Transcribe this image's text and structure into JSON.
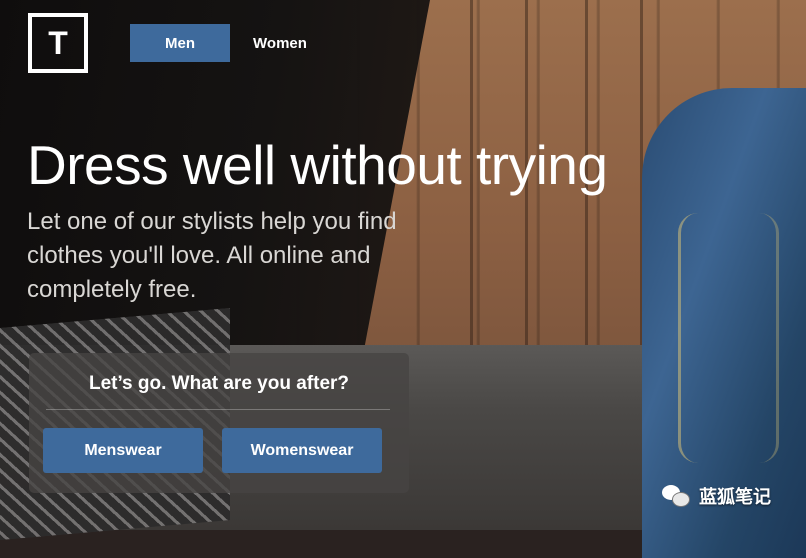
{
  "brand": {
    "logo_letter": "T"
  },
  "nav": {
    "tabs": [
      {
        "label": "Men",
        "active": true
      },
      {
        "label": "Women",
        "active": false
      }
    ]
  },
  "hero": {
    "title": "Dress well without trying",
    "subtitle": "Let one of our stylists help you find clothes you'll love. All online and completely free."
  },
  "cta_card": {
    "prompt": "Let’s go. What are you after?",
    "buttons": [
      {
        "label": "Menswear"
      },
      {
        "label": "Womenswear"
      }
    ]
  },
  "watermark": {
    "text": "蓝狐笔记",
    "icon": "wechat-icon"
  },
  "colors": {
    "accent_blue": "#3e6a9c",
    "text_white": "#ffffff",
    "subtitle_gray": "#d9d7d4"
  }
}
